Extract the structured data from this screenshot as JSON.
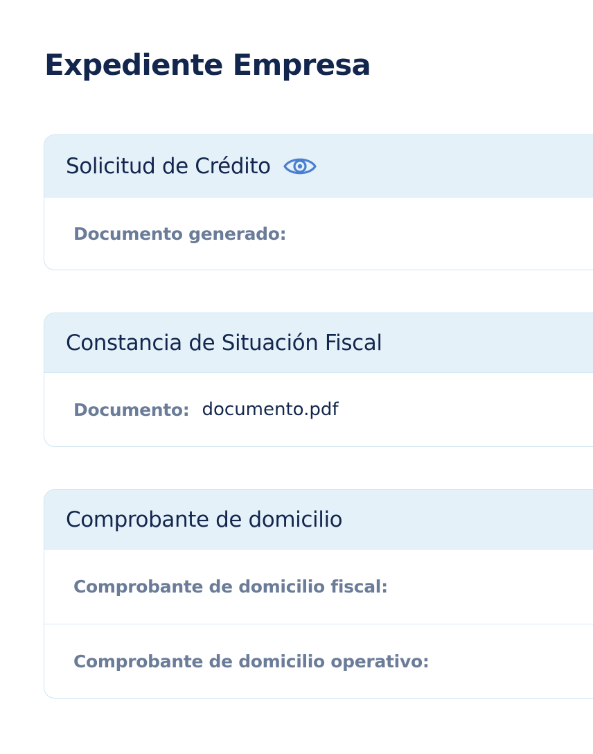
{
  "page": {
    "title": "Expediente Empresa"
  },
  "cards": [
    {
      "title": "Solicitud de Crédito",
      "icon": "eye-icon",
      "rows": [
        {
          "label": "Documento generado:",
          "value": ""
        }
      ]
    },
    {
      "title": "Constancia de Situación Fiscal",
      "rows": [
        {
          "label": "Documento:",
          "value": "documento.pdf"
        }
      ]
    },
    {
      "title": "Comprobante de domicilio",
      "rows": [
        {
          "label": "Comprobante de domicilio fiscal:",
          "value": ""
        },
        {
          "label": "Comprobante de domicilio operativo:",
          "value": ""
        }
      ]
    }
  ],
  "colors": {
    "title": "#13264d",
    "header_bg": "#e4f1f9",
    "border": "#cfe4f1",
    "label": "#6a7c98",
    "icon": "#4a7fd0"
  }
}
